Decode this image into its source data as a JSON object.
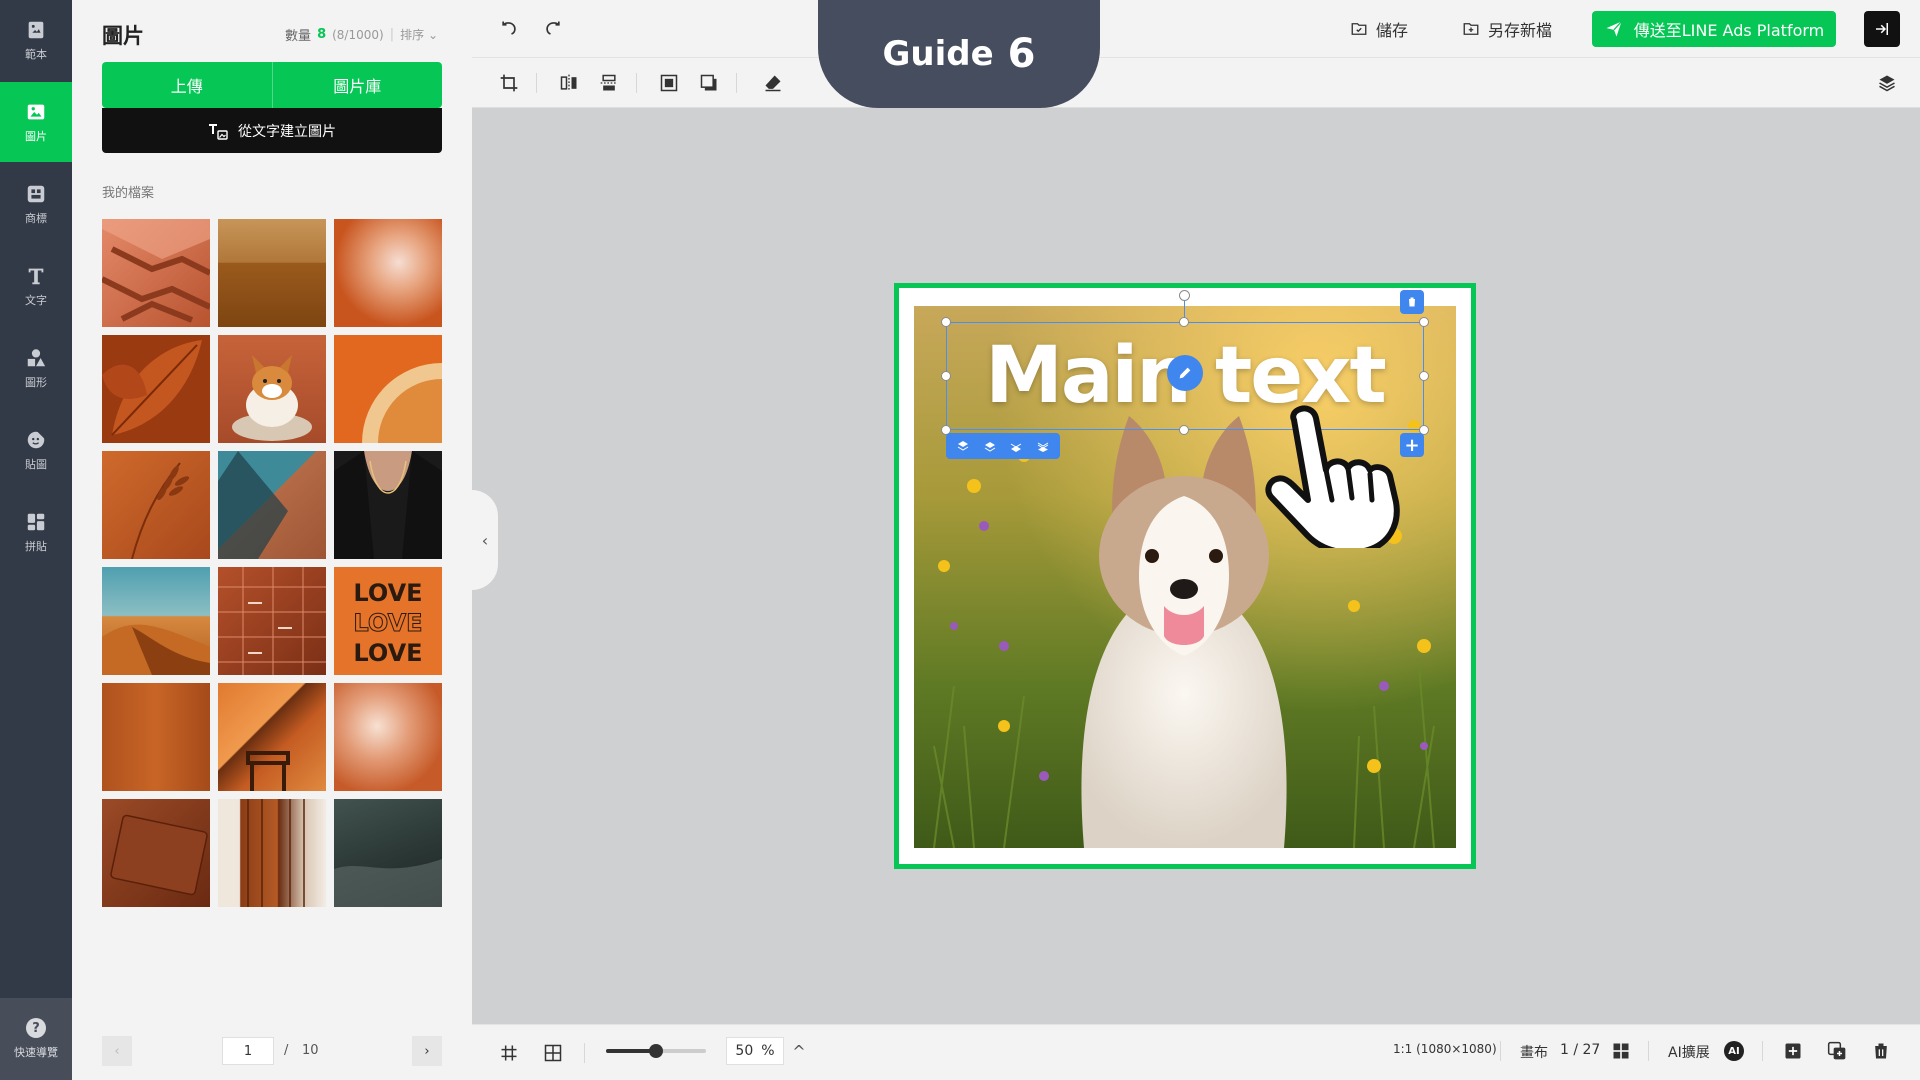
{
  "rail": {
    "items": [
      {
        "label": "範本",
        "icon": "template-icon"
      },
      {
        "label": "圖片",
        "icon": "image-icon"
      },
      {
        "label": "商標",
        "icon": "logo-icon"
      },
      {
        "label": "文字",
        "icon": "text-icon"
      },
      {
        "label": "圖形",
        "icon": "shapes-icon"
      },
      {
        "label": "貼圖",
        "icon": "sticker-icon"
      },
      {
        "label": "拼貼",
        "icon": "collage-icon"
      }
    ],
    "active_index": 1,
    "help_label": "快速導覽"
  },
  "panel": {
    "title": "圖片",
    "count_label": "數量",
    "count_value": "8",
    "count_limit": "(8/1000)",
    "sort_label": "排序",
    "upload_label": "上傳",
    "library_label": "圖片庫",
    "text_to_image_label": "從文字建立圖片",
    "section_label": "我的檔案",
    "love_word": "LOVE",
    "pager": {
      "current": "1",
      "separator": "/",
      "total": "10"
    }
  },
  "topbar": {
    "save_label": "儲存",
    "save_as_label": "另存新檔",
    "send_label": "傳送至LINE Ads Platform",
    "guide_word": "Guide",
    "guide_number": "6"
  },
  "canvas": {
    "main_text": "Main text"
  },
  "bottombar": {
    "zoom_value": "50",
    "zoom_unit": "%",
    "zoom_fraction": 0.5,
    "ratio_label": "1:1 (1080×1080)",
    "canvas_label": "畫布",
    "canvas_pages": "1 / 27",
    "ai_expand_label": "AI擴展",
    "ai_badge": "AI"
  },
  "colors": {
    "accent": "#06c755",
    "rail_bg": "#333a47",
    "selection": "#3f86ee",
    "guide_bg": "#464d5e"
  }
}
